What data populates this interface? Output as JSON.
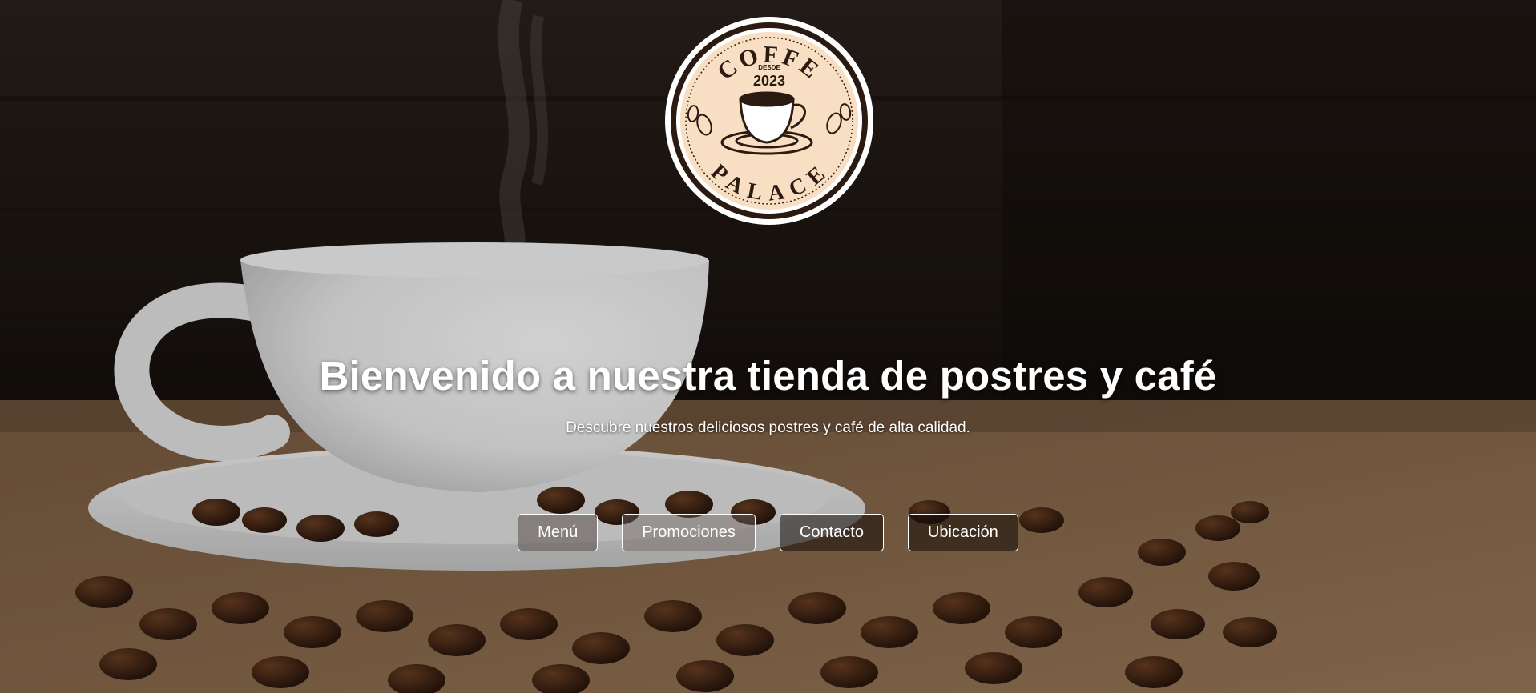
{
  "logo": {
    "top_text": "COFFE",
    "since_label": "DESDE",
    "year": "2023",
    "bottom_text": "PALACE"
  },
  "hero": {
    "title": "Bienvenido a nuestra tienda de postres y café",
    "subtitle": "Descubre nuestros deliciosos postres y café de alta calidad."
  },
  "nav": {
    "items": [
      {
        "label": "Menú"
      },
      {
        "label": "Promociones"
      },
      {
        "label": "Contacto"
      },
      {
        "label": "Ubicación"
      }
    ]
  },
  "colors": {
    "logo_fill": "#f8dfc4",
    "logo_ring": "#2b1a12",
    "text": "#ffffff"
  }
}
